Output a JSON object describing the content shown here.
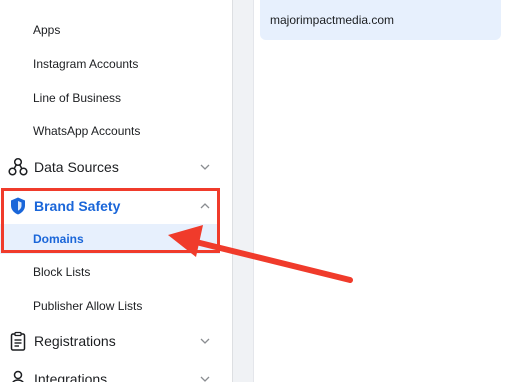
{
  "sidebar": {
    "sub_items_top": [
      {
        "label": "Apps"
      },
      {
        "label": "Instagram Accounts"
      },
      {
        "label": "Line of Business"
      },
      {
        "label": "WhatsApp Accounts"
      }
    ],
    "data_sources": {
      "label": "Data Sources",
      "icon": "data-sources-icon",
      "chevron": "chevron-down-icon"
    },
    "brand_safety": {
      "label": "Brand Safety",
      "icon": "shield-icon",
      "chevron": "chevron-up-icon",
      "expanded": true
    },
    "brand_safety_items": [
      {
        "label": "Domains",
        "selected": true
      },
      {
        "label": "Block Lists"
      },
      {
        "label": "Publisher Allow Lists"
      }
    ],
    "registrations": {
      "label": "Registrations",
      "icon": "clipboard-icon",
      "chevron": "chevron-down-icon"
    },
    "integrations": {
      "label": "Integrations",
      "icon": "person-icon",
      "chevron": "chevron-down-icon"
    }
  },
  "main": {
    "domains": [
      {
        "name": "majorimpactmedia.com"
      }
    ]
  },
  "colors": {
    "accent": "#1a66d9",
    "selected_bg": "#e7f0fd",
    "annotation_red": "#f03b2b"
  }
}
